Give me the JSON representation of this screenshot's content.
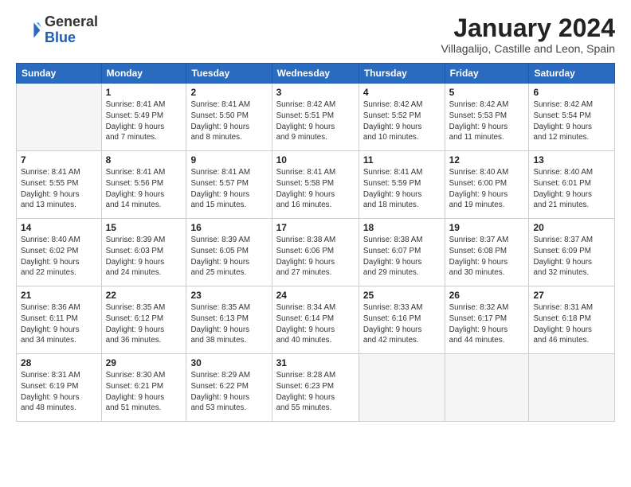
{
  "logo": {
    "general": "General",
    "blue": "Blue"
  },
  "header": {
    "title": "January 2024",
    "subtitle": "Villagalijo, Castille and Leon, Spain"
  },
  "columns": [
    "Sunday",
    "Monday",
    "Tuesday",
    "Wednesday",
    "Thursday",
    "Friday",
    "Saturday"
  ],
  "weeks": [
    [
      {
        "day": "",
        "detail": ""
      },
      {
        "day": "1",
        "detail": "Sunrise: 8:41 AM\nSunset: 5:49 PM\nDaylight: 9 hours\nand 7 minutes."
      },
      {
        "day": "2",
        "detail": "Sunrise: 8:41 AM\nSunset: 5:50 PM\nDaylight: 9 hours\nand 8 minutes."
      },
      {
        "day": "3",
        "detail": "Sunrise: 8:42 AM\nSunset: 5:51 PM\nDaylight: 9 hours\nand 9 minutes."
      },
      {
        "day": "4",
        "detail": "Sunrise: 8:42 AM\nSunset: 5:52 PM\nDaylight: 9 hours\nand 10 minutes."
      },
      {
        "day": "5",
        "detail": "Sunrise: 8:42 AM\nSunset: 5:53 PM\nDaylight: 9 hours\nand 11 minutes."
      },
      {
        "day": "6",
        "detail": "Sunrise: 8:42 AM\nSunset: 5:54 PM\nDaylight: 9 hours\nand 12 minutes."
      }
    ],
    [
      {
        "day": "7",
        "detail": "Sunrise: 8:41 AM\nSunset: 5:55 PM\nDaylight: 9 hours\nand 13 minutes."
      },
      {
        "day": "8",
        "detail": "Sunrise: 8:41 AM\nSunset: 5:56 PM\nDaylight: 9 hours\nand 14 minutes."
      },
      {
        "day": "9",
        "detail": "Sunrise: 8:41 AM\nSunset: 5:57 PM\nDaylight: 9 hours\nand 15 minutes."
      },
      {
        "day": "10",
        "detail": "Sunrise: 8:41 AM\nSunset: 5:58 PM\nDaylight: 9 hours\nand 16 minutes."
      },
      {
        "day": "11",
        "detail": "Sunrise: 8:41 AM\nSunset: 5:59 PM\nDaylight: 9 hours\nand 18 minutes."
      },
      {
        "day": "12",
        "detail": "Sunrise: 8:40 AM\nSunset: 6:00 PM\nDaylight: 9 hours\nand 19 minutes."
      },
      {
        "day": "13",
        "detail": "Sunrise: 8:40 AM\nSunset: 6:01 PM\nDaylight: 9 hours\nand 21 minutes."
      }
    ],
    [
      {
        "day": "14",
        "detail": "Sunrise: 8:40 AM\nSunset: 6:02 PM\nDaylight: 9 hours\nand 22 minutes."
      },
      {
        "day": "15",
        "detail": "Sunrise: 8:39 AM\nSunset: 6:03 PM\nDaylight: 9 hours\nand 24 minutes."
      },
      {
        "day": "16",
        "detail": "Sunrise: 8:39 AM\nSunset: 6:05 PM\nDaylight: 9 hours\nand 25 minutes."
      },
      {
        "day": "17",
        "detail": "Sunrise: 8:38 AM\nSunset: 6:06 PM\nDaylight: 9 hours\nand 27 minutes."
      },
      {
        "day": "18",
        "detail": "Sunrise: 8:38 AM\nSunset: 6:07 PM\nDaylight: 9 hours\nand 29 minutes."
      },
      {
        "day": "19",
        "detail": "Sunrise: 8:37 AM\nSunset: 6:08 PM\nDaylight: 9 hours\nand 30 minutes."
      },
      {
        "day": "20",
        "detail": "Sunrise: 8:37 AM\nSunset: 6:09 PM\nDaylight: 9 hours\nand 32 minutes."
      }
    ],
    [
      {
        "day": "21",
        "detail": "Sunrise: 8:36 AM\nSunset: 6:11 PM\nDaylight: 9 hours\nand 34 minutes."
      },
      {
        "day": "22",
        "detail": "Sunrise: 8:35 AM\nSunset: 6:12 PM\nDaylight: 9 hours\nand 36 minutes."
      },
      {
        "day": "23",
        "detail": "Sunrise: 8:35 AM\nSunset: 6:13 PM\nDaylight: 9 hours\nand 38 minutes."
      },
      {
        "day": "24",
        "detail": "Sunrise: 8:34 AM\nSunset: 6:14 PM\nDaylight: 9 hours\nand 40 minutes."
      },
      {
        "day": "25",
        "detail": "Sunrise: 8:33 AM\nSunset: 6:16 PM\nDaylight: 9 hours\nand 42 minutes."
      },
      {
        "day": "26",
        "detail": "Sunrise: 8:32 AM\nSunset: 6:17 PM\nDaylight: 9 hours\nand 44 minutes."
      },
      {
        "day": "27",
        "detail": "Sunrise: 8:31 AM\nSunset: 6:18 PM\nDaylight: 9 hours\nand 46 minutes."
      }
    ],
    [
      {
        "day": "28",
        "detail": "Sunrise: 8:31 AM\nSunset: 6:19 PM\nDaylight: 9 hours\nand 48 minutes."
      },
      {
        "day": "29",
        "detail": "Sunrise: 8:30 AM\nSunset: 6:21 PM\nDaylight: 9 hours\nand 51 minutes."
      },
      {
        "day": "30",
        "detail": "Sunrise: 8:29 AM\nSunset: 6:22 PM\nDaylight: 9 hours\nand 53 minutes."
      },
      {
        "day": "31",
        "detail": "Sunrise: 8:28 AM\nSunset: 6:23 PM\nDaylight: 9 hours\nand 55 minutes."
      },
      {
        "day": "",
        "detail": ""
      },
      {
        "day": "",
        "detail": ""
      },
      {
        "day": "",
        "detail": ""
      }
    ]
  ]
}
